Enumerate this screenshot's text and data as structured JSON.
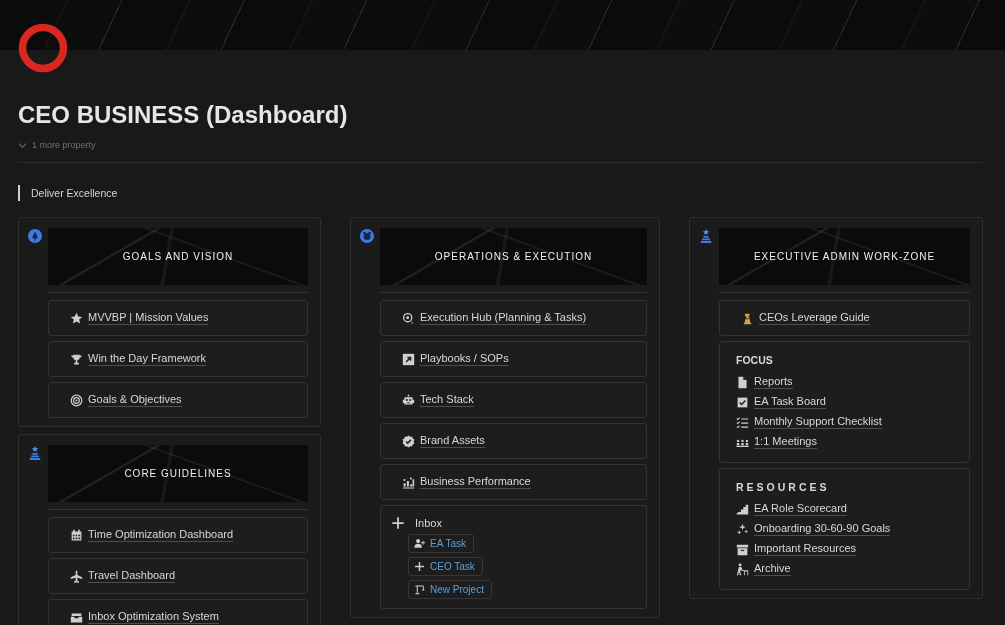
{
  "page": {
    "title": "CEO BUSINESS (Dashboard)",
    "property_toggle": "1 more property",
    "quote": "Deliver Excellence"
  },
  "columns": [
    {
      "sections": [
        {
          "banner": "GOALS AND VISION",
          "blocks": [
            {
              "kind": "link",
              "label": "MVVBP | Mission Values"
            },
            {
              "kind": "link",
              "label": "Win the Day Framework"
            },
            {
              "kind": "link",
              "label": "Goals & Objectives"
            }
          ]
        },
        {
          "banner": "CORE GUIDELINES",
          "blocks": [
            {
              "kind": "link",
              "label": "Time Optimization Dashboard"
            },
            {
              "kind": "link",
              "label": "Travel Dashboard"
            },
            {
              "kind": "link",
              "label": "Inbox Optimization System"
            }
          ]
        }
      ]
    },
    {
      "sections": [
        {
          "banner": "OPERATIONS & EXECUTION",
          "blocks": [
            {
              "kind": "link",
              "label": "Execution Hub (Planning & Tasks)"
            },
            {
              "kind": "link",
              "label": "Playbooks / SOPs"
            },
            {
              "kind": "link",
              "label": "Tech Stack"
            },
            {
              "kind": "link",
              "label": "Brand Assets"
            },
            {
              "kind": "link",
              "label": "Business Performance"
            },
            {
              "kind": "buttons",
              "heading": "Inbox",
              "buttons": [
                "EA Task",
                "CEO Task",
                "New Project"
              ]
            }
          ]
        }
      ]
    },
    {
      "sections": [
        {
          "banner": "EXECUTIVE ADMIN WORK-ZONE",
          "blocks": [
            {
              "kind": "link",
              "label": "CEOs Leverage Guide"
            },
            {
              "kind": "list",
              "heading": "FOCUS",
              "letter_spaced": false,
              "items": [
                "Reports",
                "EA Task Board",
                "Monthly Support Checklist",
                "1:1 Meetings"
              ]
            },
            {
              "kind": "list",
              "heading": "RESOURCES",
              "letter_spaced": true,
              "items": [
                "EA Role Scorecard",
                "Onboarding 30-60-90 Goals",
                "Important Resources",
                "Archive"
              ]
            }
          ]
        }
      ]
    }
  ]
}
